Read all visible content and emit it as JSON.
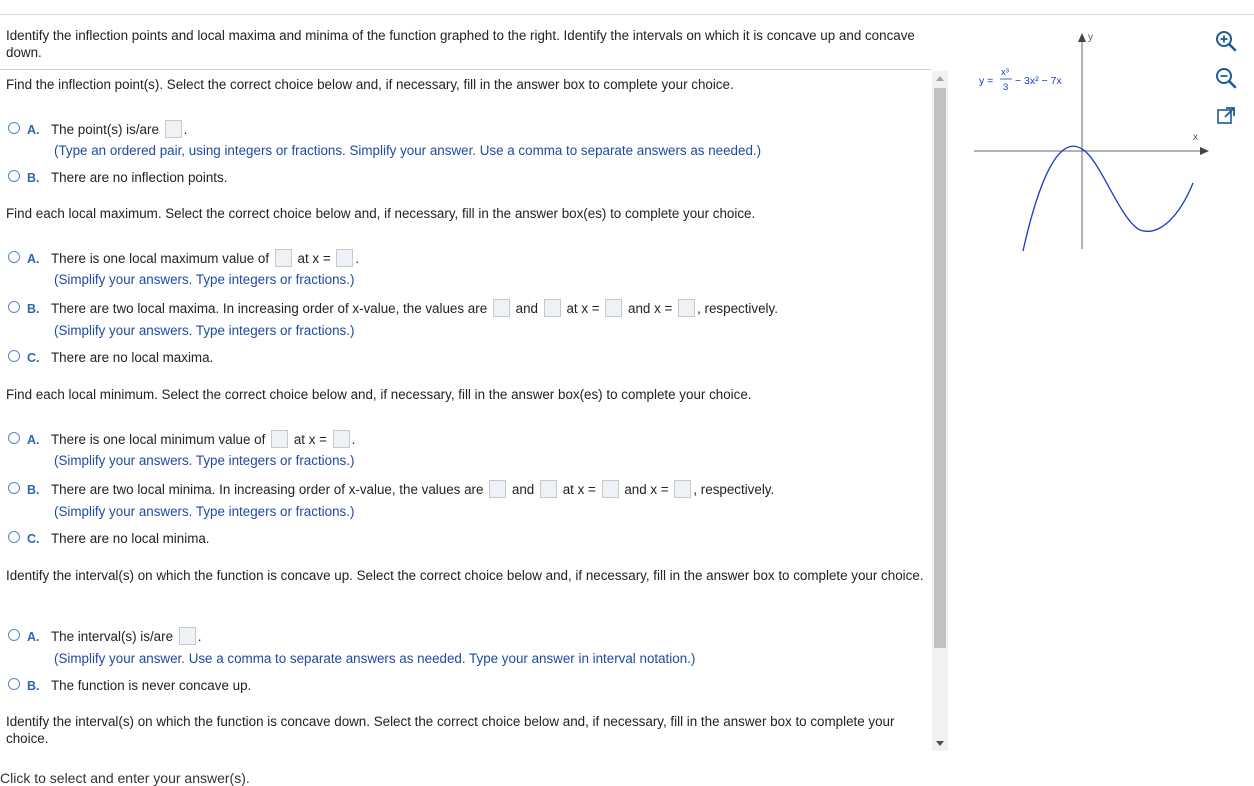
{
  "question": "Identify the inflection points and local maxima and minima of the function graphed to the right. Identify the intervals on which it is concave up and concave down.",
  "graph": {
    "y_prefix": "y =",
    "numerator": "x³",
    "denominator": "3",
    "rest": "− 3x² − 7x",
    "x_axis_label": "x",
    "y_axis_label": "y",
    "curve_color": "#1a3ccc"
  },
  "parts": {
    "inflection": {
      "prompt": "Find the inflection point(s). Select the correct choice below and, if necessary, fill in the answer box to complete your choice.",
      "a_letter": "A.",
      "a_text": "The point(s) is/are",
      "a_hint": "(Type an ordered pair, using integers or fractions. Simplify your answer. Use a comma to separate answers as needed.)",
      "b_letter": "B.",
      "b_text": "There are no inflection points."
    },
    "maximum": {
      "prompt": "Find each local maximum. Select the correct choice below and, if necessary, fill in the answer box(es) to complete your choice.",
      "a_letter": "A.",
      "a_text1": "There is one local maximum value of",
      "a_text2": "at x =",
      "a_hint": "(Simplify your answers. Type integers or fractions.)",
      "b_letter": "B.",
      "b_text1": "There are two local maxima. In increasing order of x-value, the values are",
      "b_and1": "and",
      "b_atx": "at x =",
      "b_and2": "and x =",
      "b_resp": ", respectively.",
      "b_hint": "(Simplify your answers. Type integers or fractions.)",
      "c_letter": "C.",
      "c_text": "There are no local maxima."
    },
    "minimum": {
      "prompt": "Find each local minimum. Select the correct choice below and, if necessary, fill in the answer box(es) to complete your choice.",
      "a_letter": "A.",
      "a_text1": "There is one local minimum value of",
      "a_text2": "at x =",
      "a_hint": "(Simplify your answers. Type integers or fractions.)",
      "b_letter": "B.",
      "b_text1": "There are two local minima. In increasing order of x-value, the values are",
      "b_and1": "and",
      "b_atx": "at x =",
      "b_and2": "and x =",
      "b_resp": ", respectively.",
      "b_hint": "(Simplify your answers. Type integers or fractions.)",
      "c_letter": "C.",
      "c_text": "There are no local minima."
    },
    "concave_up": {
      "prompt": "Identify the interval(s) on which the function is concave up. Select the correct choice below and, if necessary, fill in the answer box to complete your choice.",
      "a_letter": "A.",
      "a_text": "The interval(s) is/are",
      "a_hint": "(Simplify your answer. Use a comma to separate answers as needed. Type your answer in interval notation.)",
      "b_letter": "B.",
      "b_text": "The function is never concave up."
    },
    "concave_down": {
      "prompt": "Identify the interval(s) on which the function is concave down. Select the correct choice below and, if necessary, fill in the answer box to complete your choice."
    }
  },
  "footer": "Click to select and enter your answer(s).",
  "tools": [
    "zoom-in-icon",
    "zoom-out-icon",
    "popout-icon"
  ]
}
